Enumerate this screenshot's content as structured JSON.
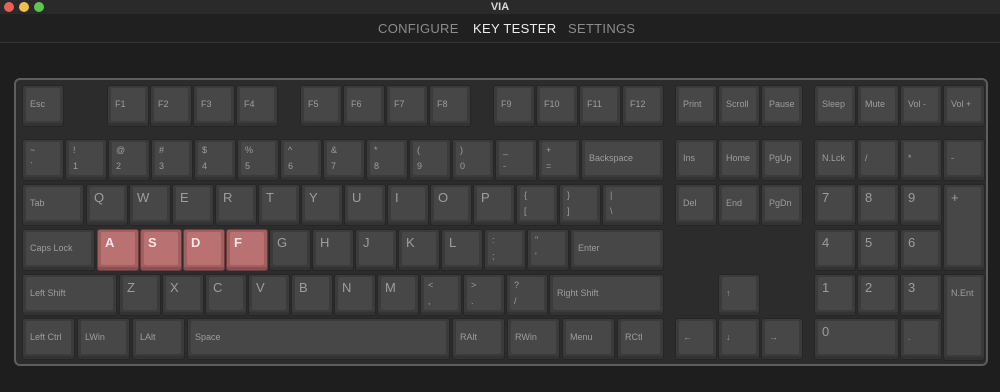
{
  "window": {
    "title": "VIA",
    "traffic_lights": {
      "close": "#ec5f57",
      "minimize": "#f4bd4f",
      "zoom": "#5ec84b"
    }
  },
  "nav": {
    "tabs": [
      {
        "label": "CONFIGURE",
        "active": false
      },
      {
        "label": "KEY TESTER",
        "active": true
      },
      {
        "label": "SETTINGS",
        "active": false
      }
    ]
  },
  "keyboard": {
    "pressed_color": "#b97171",
    "keys": [
      {
        "id": "esc",
        "label": "Esc"
      },
      {
        "id": "f1",
        "label": "F1"
      },
      {
        "id": "f2",
        "label": "F2"
      },
      {
        "id": "f3",
        "label": "F3"
      },
      {
        "id": "f4",
        "label": "F4"
      },
      {
        "id": "f5",
        "label": "F5"
      },
      {
        "id": "f6",
        "label": "F6"
      },
      {
        "id": "f7",
        "label": "F7"
      },
      {
        "id": "f8",
        "label": "F8"
      },
      {
        "id": "f9",
        "label": "F9"
      },
      {
        "id": "f10",
        "label": "F10"
      },
      {
        "id": "f11",
        "label": "F11"
      },
      {
        "id": "f12",
        "label": "F12"
      },
      {
        "id": "print",
        "label": "Print"
      },
      {
        "id": "scroll",
        "label": "Scroll"
      },
      {
        "id": "pause",
        "label": "Pause"
      },
      {
        "id": "sleep",
        "label": "Sleep"
      },
      {
        "id": "mute",
        "label": "Mute"
      },
      {
        "id": "vol-down",
        "label": "Vol -"
      },
      {
        "id": "vol-up",
        "label": "Vol +"
      },
      {
        "id": "grave",
        "shift": "~",
        "base": "`"
      },
      {
        "id": "1",
        "shift": "!",
        "base": "1"
      },
      {
        "id": "2",
        "shift": "@",
        "base": "2"
      },
      {
        "id": "3",
        "shift": "#",
        "base": "3"
      },
      {
        "id": "4",
        "shift": "$",
        "base": "4"
      },
      {
        "id": "5",
        "shift": "%",
        "base": "5"
      },
      {
        "id": "6",
        "shift": "^",
        "base": "6"
      },
      {
        "id": "7",
        "shift": "&",
        "base": "7"
      },
      {
        "id": "8",
        "shift": "*",
        "base": "8"
      },
      {
        "id": "9",
        "shift": "(",
        "base": "9"
      },
      {
        "id": "0",
        "shift": ")",
        "base": "0"
      },
      {
        "id": "minus",
        "shift": "_",
        "base": "-"
      },
      {
        "id": "equal",
        "shift": "+",
        "base": "="
      },
      {
        "id": "backspace",
        "label": "Backspace"
      },
      {
        "id": "ins",
        "label": "Ins"
      },
      {
        "id": "home",
        "label": "Home"
      },
      {
        "id": "pgup",
        "label": "PgUp"
      },
      {
        "id": "nlck",
        "label": "N.Lck"
      },
      {
        "id": "kp-slash",
        "label": "/"
      },
      {
        "id": "kp-star",
        "label": "*"
      },
      {
        "id": "kp-minus",
        "label": "-"
      },
      {
        "id": "tab",
        "label": "Tab"
      },
      {
        "id": "q",
        "label": "Q",
        "big": true
      },
      {
        "id": "w",
        "label": "W",
        "big": true
      },
      {
        "id": "e",
        "label": "E",
        "big": true
      },
      {
        "id": "r",
        "label": "R",
        "big": true
      },
      {
        "id": "t",
        "label": "T",
        "big": true
      },
      {
        "id": "y",
        "label": "Y",
        "big": true
      },
      {
        "id": "u",
        "label": "U",
        "big": true
      },
      {
        "id": "i",
        "label": "I",
        "big": true
      },
      {
        "id": "o",
        "label": "O",
        "big": true
      },
      {
        "id": "p",
        "label": "P",
        "big": true
      },
      {
        "id": "lbracket",
        "shift": "{",
        "base": "["
      },
      {
        "id": "rbracket",
        "shift": "}",
        "base": "]"
      },
      {
        "id": "backslash",
        "shift": "|",
        "base": "\\"
      },
      {
        "id": "del",
        "label": "Del"
      },
      {
        "id": "end",
        "label": "End"
      },
      {
        "id": "pgdn",
        "label": "PgDn"
      },
      {
        "id": "kp7",
        "label": "7",
        "big": true
      },
      {
        "id": "kp8",
        "label": "8",
        "big": true
      },
      {
        "id": "kp9",
        "label": "9",
        "big": true
      },
      {
        "id": "kp-plus",
        "label": "+",
        "big": true
      },
      {
        "id": "caps",
        "label": "Caps Lock"
      },
      {
        "id": "a",
        "label": "A",
        "big": true,
        "pressed": true
      },
      {
        "id": "s",
        "label": "S",
        "big": true,
        "pressed": true
      },
      {
        "id": "d",
        "label": "D",
        "big": true,
        "pressed": true
      },
      {
        "id": "f",
        "label": "F",
        "big": true,
        "pressed": true
      },
      {
        "id": "g",
        "label": "G",
        "big": true
      },
      {
        "id": "h",
        "label": "H",
        "big": true
      },
      {
        "id": "j",
        "label": "J",
        "big": true
      },
      {
        "id": "k",
        "label": "K",
        "big": true
      },
      {
        "id": "l",
        "label": "L",
        "big": true
      },
      {
        "id": "semicolon",
        "shift": ":",
        "base": ";"
      },
      {
        "id": "quote",
        "shift": "\"",
        "base": "'"
      },
      {
        "id": "enter",
        "label": "Enter"
      },
      {
        "id": "kp4",
        "label": "4",
        "big": true
      },
      {
        "id": "kp5",
        "label": "5",
        "big": true
      },
      {
        "id": "kp6",
        "label": "6",
        "big": true
      },
      {
        "id": "lshift",
        "label": "Left Shift"
      },
      {
        "id": "z",
        "label": "Z",
        "big": true
      },
      {
        "id": "x",
        "label": "X",
        "big": true
      },
      {
        "id": "c",
        "label": "C",
        "big": true
      },
      {
        "id": "v",
        "label": "V",
        "big": true
      },
      {
        "id": "b",
        "label": "B",
        "big": true
      },
      {
        "id": "n",
        "label": "N",
        "big": true
      },
      {
        "id": "m",
        "label": "M",
        "big": true
      },
      {
        "id": "comma",
        "shift": "<",
        "base": ","
      },
      {
        "id": "period",
        "shift": ">",
        "base": "."
      },
      {
        "id": "slash",
        "shift": "?",
        "base": "/"
      },
      {
        "id": "rshift",
        "label": "Right Shift"
      },
      {
        "id": "up",
        "label": "↑"
      },
      {
        "id": "kp1",
        "label": "1",
        "big": true
      },
      {
        "id": "kp2",
        "label": "2",
        "big": true
      },
      {
        "id": "kp3",
        "label": "3",
        "big": true
      },
      {
        "id": "kp-enter",
        "label": "N.Ent"
      },
      {
        "id": "lctrl",
        "label": "Left Ctrl"
      },
      {
        "id": "lwin",
        "label": "LWin"
      },
      {
        "id": "lalt",
        "label": "LAlt"
      },
      {
        "id": "space",
        "label": "Space"
      },
      {
        "id": "ralt",
        "label": "RAlt"
      },
      {
        "id": "rwin",
        "label": "RWin"
      },
      {
        "id": "menu",
        "label": "Menu"
      },
      {
        "id": "rctl",
        "label": "RCtl"
      },
      {
        "id": "left",
        "label": "←"
      },
      {
        "id": "down",
        "label": "↓"
      },
      {
        "id": "right",
        "label": "→"
      },
      {
        "id": "kp0",
        "label": "0",
        "big": true
      },
      {
        "id": "kp-dot",
        "label": "."
      }
    ]
  }
}
